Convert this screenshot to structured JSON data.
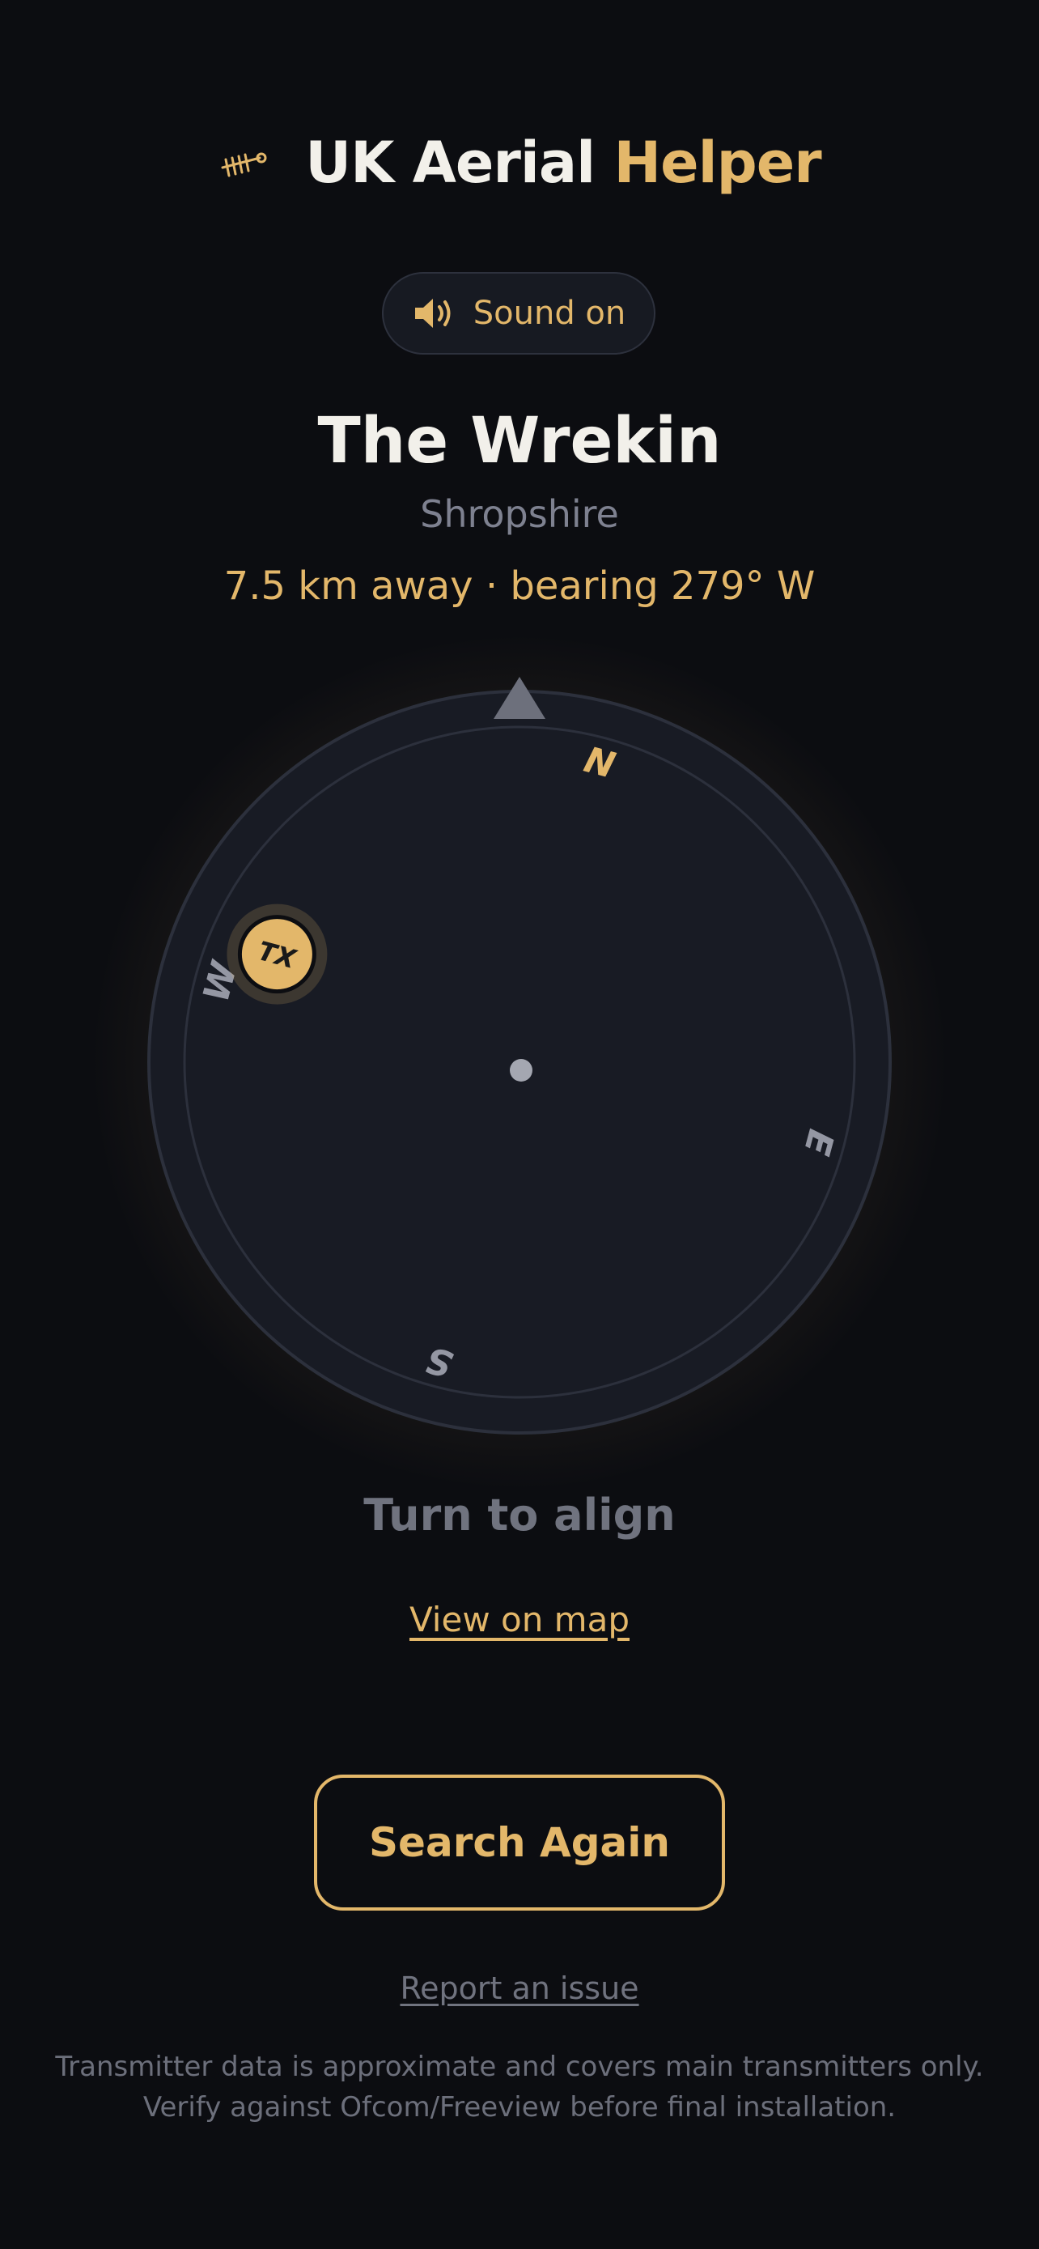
{
  "header": {
    "logo_icon": "aerial-antenna-icon",
    "title_main": "UK Aerial",
    "title_accent": "Helper"
  },
  "sound": {
    "label": "Sound on",
    "icon": "speaker-icon"
  },
  "location": {
    "name": "The Wrekin",
    "region": "Shropshire",
    "distance_bearing": "7.5 km away · bearing 279° W"
  },
  "compass": {
    "north_label": "N",
    "east_label": "E",
    "south_label": "S",
    "west_label": "W",
    "transmitter_label": "TX",
    "bearing_deg": 279,
    "dial_rotation_deg": 15
  },
  "status": {
    "align_text": "Turn to align"
  },
  "links": {
    "map": "View on map",
    "report": "Report an issue"
  },
  "actions": {
    "search_again": "Search Again"
  },
  "footer": {
    "disclaimer": "Transmitter data is approximate and covers main transmitters only. Verify against Ofcom/Freeview before final installation."
  },
  "colors": {
    "background": "#0c0d11",
    "accent": "#e3b76a",
    "muted": "#70737f",
    "dial": "#181b24"
  }
}
